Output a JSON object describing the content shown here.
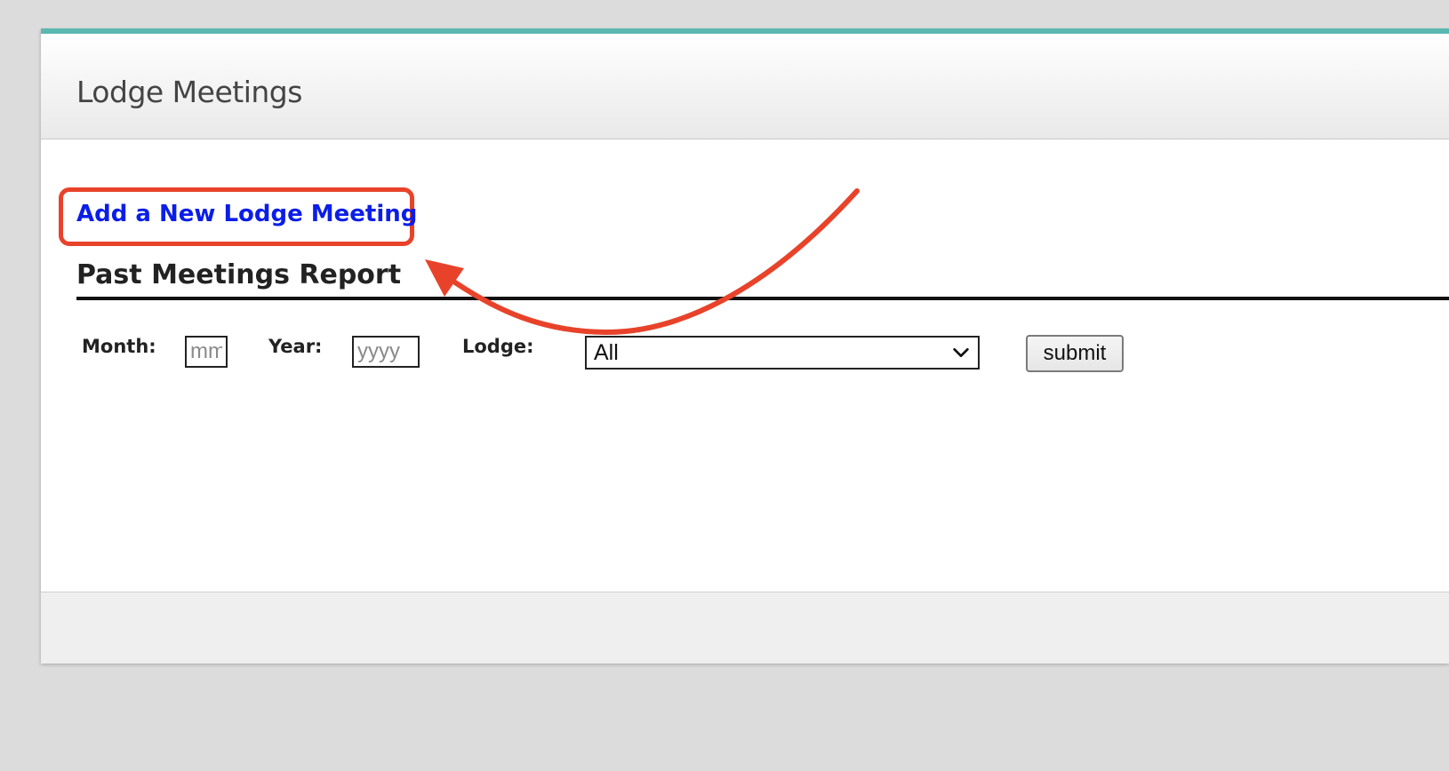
{
  "page": {
    "title": "Lodge Meetings"
  },
  "actions": {
    "add_meeting_label": "Add a New Lodge Meeting"
  },
  "report": {
    "heading": "Past Meetings Report",
    "month_label": "Month:",
    "month_placeholder": "mm",
    "year_label": "Year:",
    "year_placeholder": "yyyy",
    "lodge_label": "Lodge:",
    "lodge_selected": "All",
    "submit_label": "submit"
  },
  "icons": {
    "select_chevron": "chevron-down-icon",
    "annotation": "curved-arrow-annotation"
  },
  "colors": {
    "accent_top_border": "#5bb8b1",
    "link": "#0b1ee8",
    "annotation": "#e8432a",
    "background": "#dcdcdc"
  }
}
